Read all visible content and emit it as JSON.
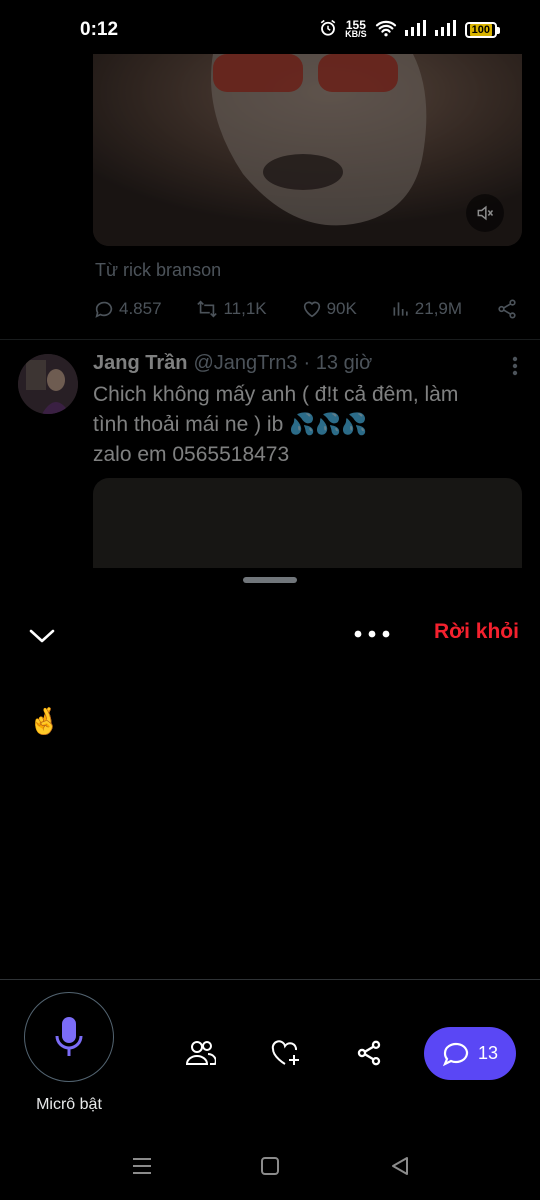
{
  "status_bar": {
    "time": "0:12",
    "net_speed_value": "155",
    "net_speed_unit": "KB/S",
    "battery": "100"
  },
  "feed": {
    "prev_tweet": {
      "source": "Từ rick branson",
      "replies": "4.857",
      "retweets": "11,1K",
      "likes": "90K",
      "views": "21,9M"
    },
    "tweet": {
      "name": "Jang Trần",
      "handle": "@JangTrn3",
      "time": "· 13 giờ",
      "text": "Chich không mấy anh ( đ!t cả đêm, làm\ntình thoải mái ne ) ib  💦💦💦\nzalo em 0565518473"
    }
  },
  "space_sheet": {
    "leave_label": "Rời khỏi",
    "speaker_emoji": "🤞",
    "mic_label": "Micrô bật",
    "chat_count": "13"
  },
  "colors": {
    "leave": "#f4212e",
    "chat_button": "#5a47f5",
    "mic_icon": "#7b6cf6",
    "battery": "#d9b400"
  }
}
